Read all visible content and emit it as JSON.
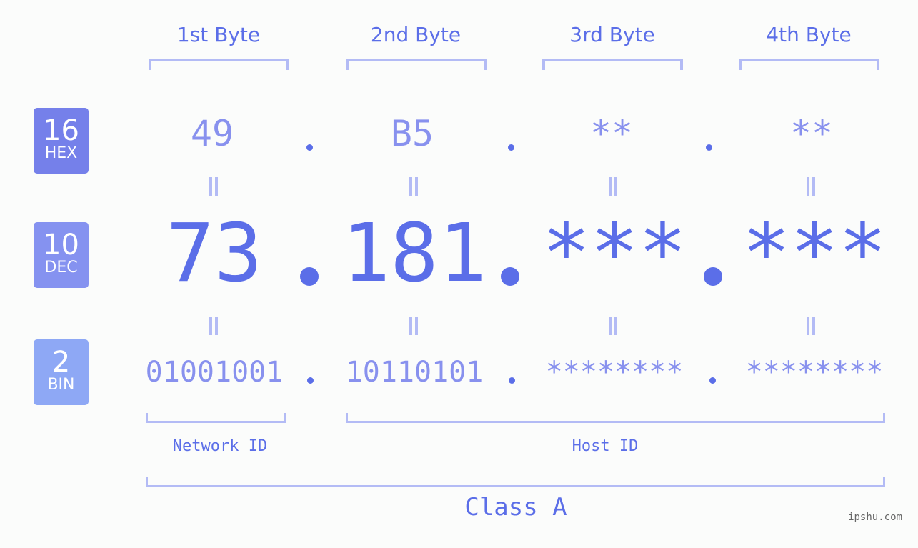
{
  "colors": {
    "accent": "#5b6ee8",
    "value": "#8891ee",
    "bracket": "#b3bbf5",
    "hex_badge": "#7580ea",
    "dec_badge": "#8592f0",
    "bin_badge": "#8ea8f5",
    "background": "#fbfcfb"
  },
  "byte_headers": [
    "1st Byte",
    "2nd Byte",
    "3rd Byte",
    "4th Byte"
  ],
  "badges": {
    "hex": {
      "number": "16",
      "label": "HEX"
    },
    "dec": {
      "number": "10",
      "label": "DEC"
    },
    "bin": {
      "number": "2",
      "label": "BIN"
    }
  },
  "hex_values": [
    "49",
    "B5",
    "**",
    "**"
  ],
  "dec_values": [
    "73",
    "181",
    "***",
    "***"
  ],
  "bin_values": [
    "01001001",
    "10110101",
    "********",
    "********"
  ],
  "separator": ".",
  "equals_symbol": "=",
  "network_id_label": "Network ID",
  "host_id_label": "Host ID",
  "class_label": "Class A",
  "watermark": "ipshu.com"
}
